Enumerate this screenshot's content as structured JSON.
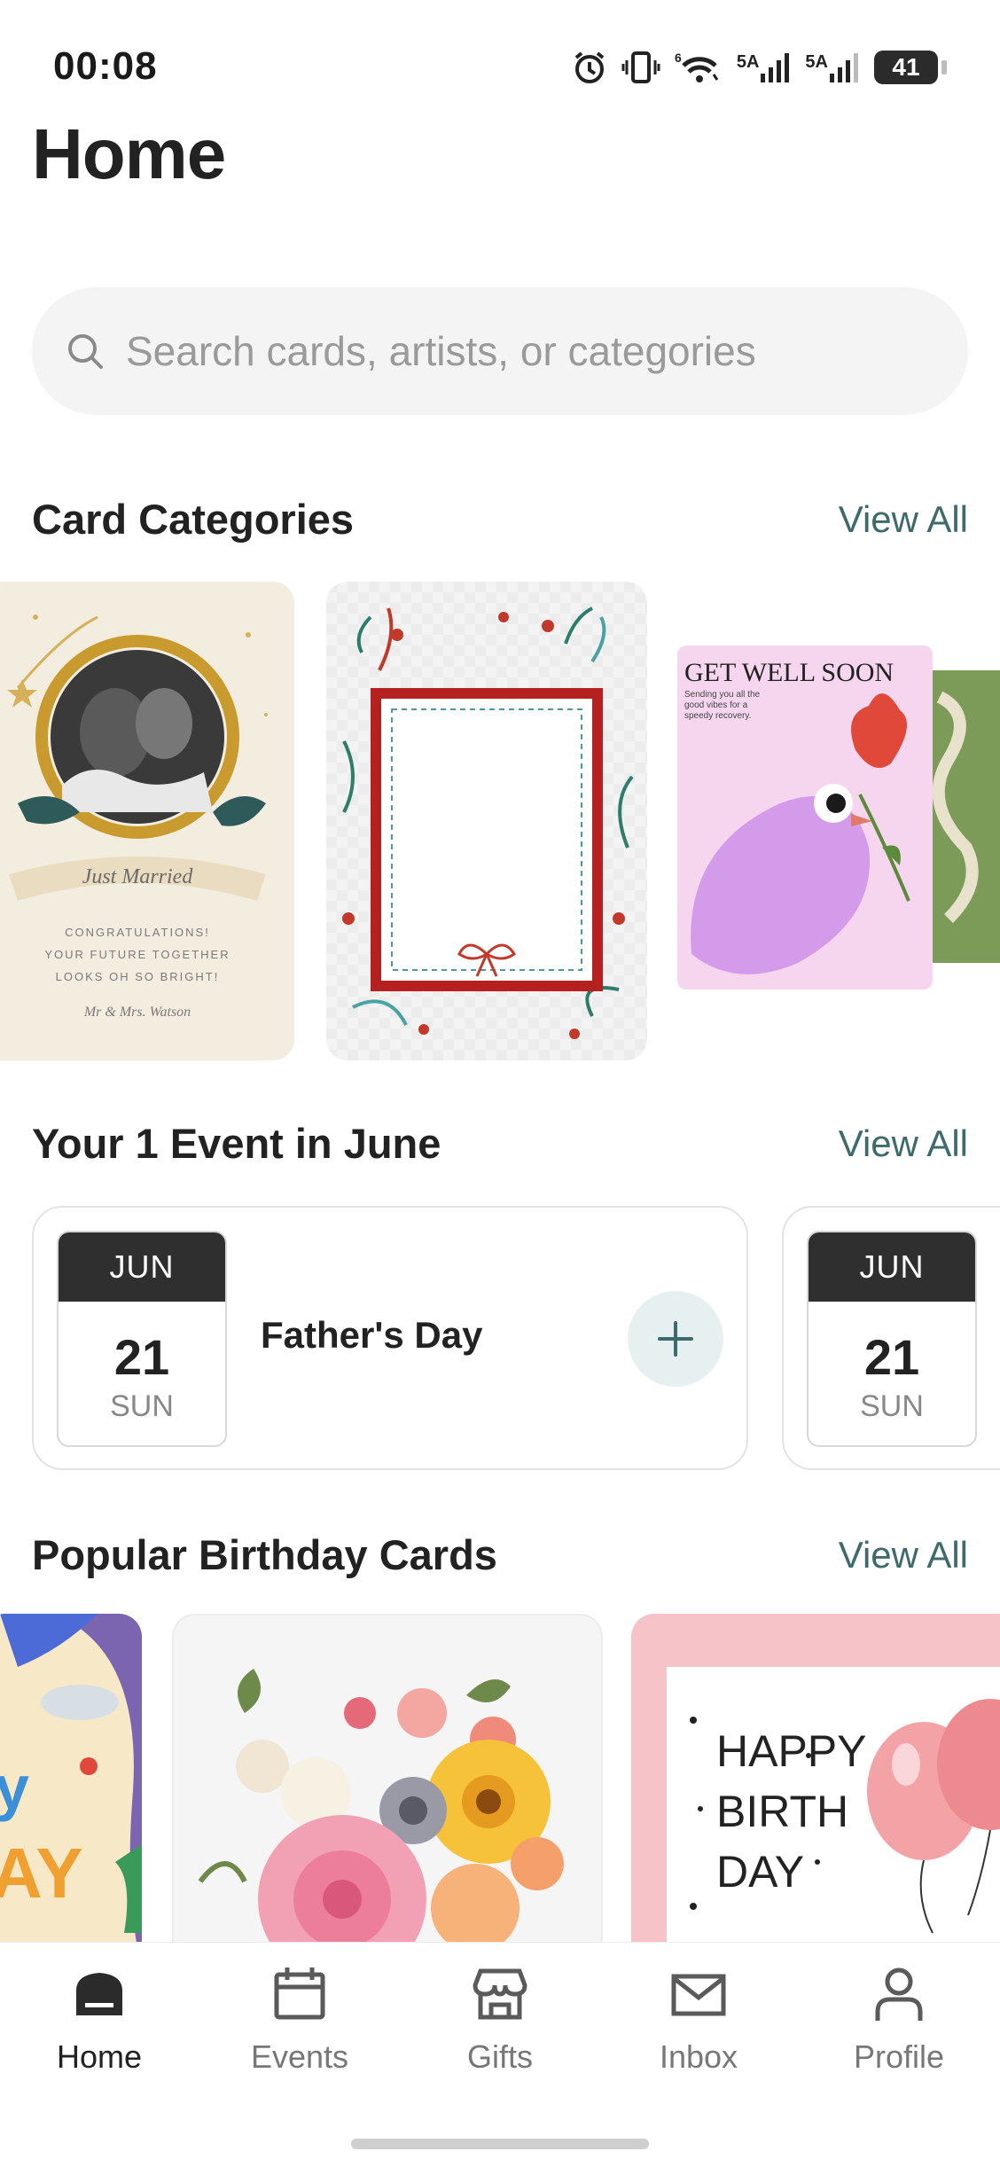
{
  "status_bar": {
    "time": "00:08",
    "network_1": "5A",
    "network_2": "5A",
    "wifi_label": "6",
    "battery": "41"
  },
  "header": {
    "title": "Home"
  },
  "search": {
    "placeholder": "Search cards, artists, or categories"
  },
  "categories": {
    "title": "Card Categories",
    "view_all": "View All",
    "cards": [
      {
        "name": "wedding",
        "text_lines": [
          "CONGRATULATIONS!",
          "YOUR FUTURE TOGETHER",
          "LOOKS OH SO BRIGHT!"
        ],
        "script": "Just Married",
        "signature": "Mr & Mrs. Watson"
      },
      {
        "name": "floral-frame"
      },
      {
        "name": "get-well",
        "headline": "GET WELL SOON",
        "subtext": "Sending you all the good vibes for a speedy recovery."
      }
    ]
  },
  "events": {
    "title": "Your 1 Event in June",
    "view_all": "View All",
    "items": [
      {
        "month": "JUN",
        "day": "21",
        "dow": "SUN",
        "name": "Father's Day"
      },
      {
        "month": "JUN",
        "day": "21",
        "dow": "SUN"
      }
    ]
  },
  "birthday": {
    "title": "Popular Birthday Cards",
    "view_all": "View All",
    "cards": [
      {
        "name": "colorful-birthday"
      },
      {
        "name": "floral-bouquet"
      },
      {
        "name": "happy-birthday-balloons",
        "text": [
          "HAPPY",
          "BIRTH",
          "DAY"
        ]
      }
    ]
  },
  "nav": {
    "items": [
      {
        "label": "Home",
        "icon": "home-icon",
        "active": true
      },
      {
        "label": "Events",
        "icon": "calendar-icon"
      },
      {
        "label": "Gifts",
        "icon": "store-icon"
      },
      {
        "label": "Inbox",
        "icon": "mail-icon"
      },
      {
        "label": "Profile",
        "icon": "person-icon"
      }
    ]
  },
  "colors": {
    "accent": "#3d6b6b",
    "date_header": "#2f2f2f",
    "add_button_bg": "#e6f0f0"
  }
}
